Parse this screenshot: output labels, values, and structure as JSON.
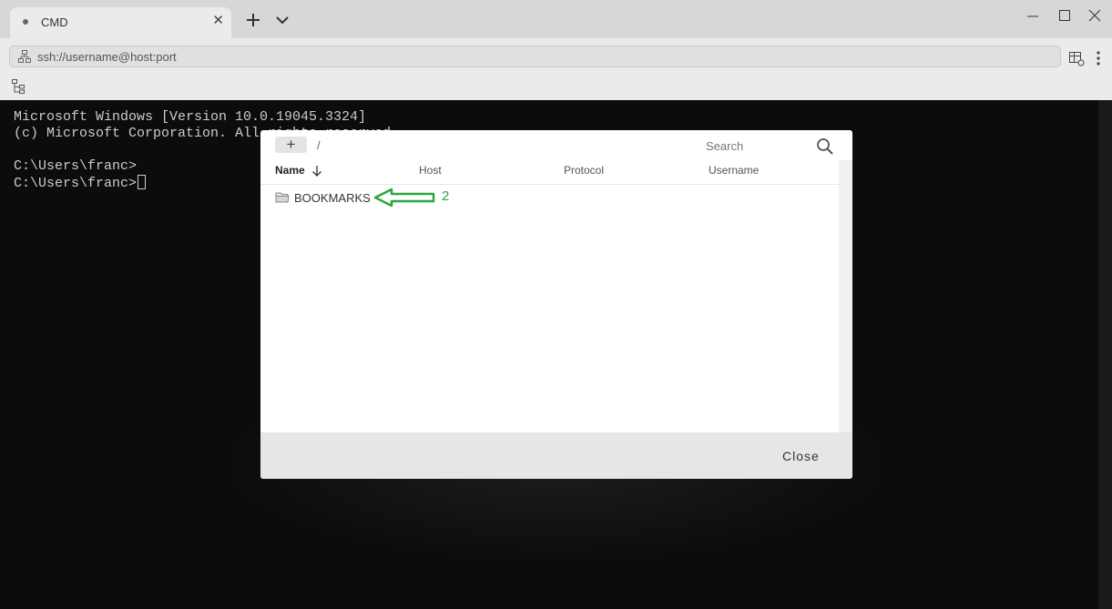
{
  "tabs": [
    {
      "title": "CMD",
      "close_glyph": "✕"
    }
  ],
  "titlebar": {
    "new_tab_icon": "plus-icon",
    "dropdown_icon": "chevron-down-icon",
    "window_controls": [
      "minimize-icon",
      "maximize-icon",
      "close-icon"
    ]
  },
  "address_bar": {
    "placeholder": "ssh://username@host:port",
    "value": ""
  },
  "terminal": {
    "lines": [
      "Microsoft Windows [Version 10.0.19045.3324]",
      "(c) Microsoft Corporation. All rights reserved.",
      "",
      "C:\\Users\\franc>",
      "C:\\Users\\franc>"
    ],
    "background": "#0c0c0c",
    "text_color": "#cccccc"
  },
  "dialog": {
    "add_button": "+",
    "path": "/",
    "search_placeholder": "Search",
    "columns": [
      "Name",
      "Host",
      "Protocol",
      "Username"
    ],
    "sort_column": "Name",
    "sort_direction": "descending",
    "rows": [
      {
        "name": "BOOKMARKS",
        "type": "folder",
        "host": "",
        "protocol": "",
        "username": ""
      }
    ],
    "close_label": "Close"
  },
  "annotation": {
    "label": "2",
    "color": "#2aa83a"
  }
}
